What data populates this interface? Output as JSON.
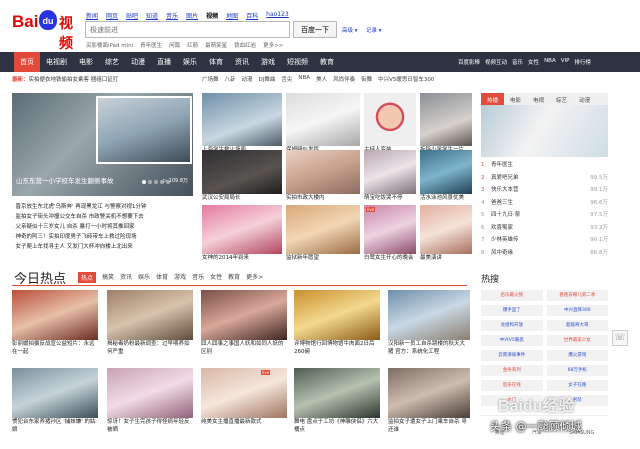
{
  "logo": {
    "text": "Bai",
    "paw": "du",
    "suffix": "视频"
  },
  "topnav": [
    "新闻",
    "网页",
    "贴吧",
    "知道",
    "音乐",
    "图片",
    "视频",
    "地图",
    "百科",
    "hao123"
  ],
  "topnav_current": "视频",
  "search": {
    "placeholder": "极速前进",
    "button": "百度一下",
    "advanced": "高级 ▾",
    "records": "记录 ▾"
  },
  "hotwords": [
    "买影楼面iPad mini",
    "青年医生",
    "闲篇",
    "红箭",
    "最萌笑星",
    "铁血红岩",
    "更多>>"
  ],
  "mainnav": {
    "items": [
      "首页",
      "电视剧",
      "电影",
      "综艺",
      "动漫",
      "直播",
      "娱乐",
      "体育",
      "资讯",
      "游戏",
      "短视频",
      "教育"
    ],
    "active": "首页",
    "right": [
      "百度影棒",
      "视频互动",
      "音乐",
      "女性",
      "NBA",
      "VIP",
      "排行榜"
    ]
  },
  "ticker": {
    "label": "最新：",
    "text": "实拍便衣地铁偷拍女乘客 捆组口证打"
  },
  "subnav": [
    "广场舞",
    "八卦",
    "动漫",
    "DJ舞曲",
    "舌尖",
    "NBA",
    "美人",
    "风尚伴奏",
    "街舞",
    "中兴V5暖思日智车300"
  ],
  "feature": {
    "caption": "山东东营一小学校车发生翻侧事故",
    "count": "▷ 109.8万"
  },
  "newslist": [
    "晋京放生东北虎'乌斯奔' 再现黑龙江 与警察对视1分钟",
    "监拍女子街头冲撞公交车自杀 市政警关机不想要下去",
    "父亲疑似十三岁女儿 自杀 暴打一小时将其推回家",
    "神奇的阿三！实拍印度男子飞砖带车上救过险现场",
    "女子爬上车找寻主人 又发门大杯冲向楼上北出来"
  ],
  "grid_row1": [
    {
      "title": "上海学生救火场面",
      "tag": ""
    },
    {
      "title": "保姆疑似发挥",
      "tag": ""
    },
    {
      "title": "主持人变装",
      "tag": ""
    },
    {
      "title": "拆除小学学生一片",
      "tag": ""
    }
  ],
  "grid_row2": [
    {
      "title": "武汉公安局局长",
      "tag": ""
    },
    {
      "title": "实拍市政大楼内",
      "tag": ""
    },
    {
      "title": "萌宝吃饭哭不停",
      "tag": ""
    },
    {
      "title": "活水泳池风景优美",
      "tag": ""
    }
  ],
  "grid_row3": [
    {
      "title": "女神的2014年到来",
      "tag": ""
    },
    {
      "title": "监狱新年愿望",
      "tag": ""
    },
    {
      "title": "白鹭女生开心的晚会",
      "tag": "live"
    },
    {
      "title": "最美演讲",
      "tag": ""
    }
  ],
  "rpanel": {
    "tabs": [
      "热播",
      "电影",
      "电视",
      "综艺",
      "动漫"
    ],
    "active": "热播",
    "hero_caption": "青年医生",
    "list": [
      {
        "n": "1",
        "name": "青年医生",
        "v": ""
      },
      {
        "n": "2",
        "name": "真爱吧兄弟",
        "v": "99.5万"
      },
      {
        "n": "3",
        "name": "快乐大本营",
        "v": "99.1万"
      },
      {
        "n": "4",
        "name": "爸爸三生",
        "v": "96.6万"
      },
      {
        "n": "5",
        "name": "四十九日·祭",
        "v": "97.5万"
      },
      {
        "n": "6",
        "name": "欢喜冤家",
        "v": "93.2万"
      },
      {
        "n": "7",
        "name": "少林英雄传",
        "v": "90.1万"
      },
      {
        "n": "8",
        "name": "风中奇缘",
        "v": "86.8万"
      }
    ]
  },
  "today": {
    "title": "今日热点",
    "tabs": [
      "热点",
      "搞笑",
      "资讯",
      "娱乐",
      "体育",
      "游戏",
      "音乐",
      "女性",
      "教育",
      "更多>"
    ],
    "active": "热点",
    "row1": [
      "彭丽媛拍摄反战宣公益短片：永远在一起",
      "揭秘毒奶粉最新调查：过早喂养如何严重",
      "囧人囧事之事国人妖和如同人妖的区别",
      "评博物馆行回博物馆牛肉面2日后260碗",
      "汉阳新一员工自杀跳楼的秋天大猪 官方：系统化工程"
    ],
    "row2": [
      "惯犯台东家养猪孙区 '捕妹嫌' 的姑娘",
      "惊讶！女子生完孩子得怪病年轻反被晒",
      "纯美女主播直播最新款式",
      "舞电 盘点于工坊《神雕侠侣》六大桶点",
      "监拍女子遭女子上门乘车自杀 寻还谁"
    ]
  },
  "hot": {
    "title": "热搜",
    "items": [
      "后乐最火猪",
      "爸爸去哪儿第二季",
      "爆手里了",
      "中兴直降300",
      "龙组和开放",
      "超级奇大哥",
      "中兴V5暖思",
      "世界最美少女",
      "云南滑坡事件",
      "爆火游戏",
      "金条系列",
      "68万手机",
      "后乐在线",
      "女子在路",
      "水门",
      "男装"
    ]
  },
  "ads": [
    "奥迪",
    "汽车",
    "SAMSUNG"
  ],
  "watermark": "Baidu经验",
  "credit": "头条 @一颱顾倾城",
  "feedback": "☏"
}
